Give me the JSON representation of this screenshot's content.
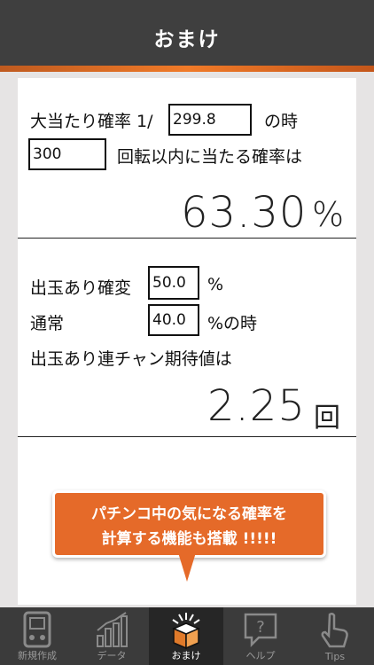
{
  "header": {
    "title": "おまけ"
  },
  "calc1": {
    "prob_label": "大当たり確率 1/",
    "prob_value": "299.8",
    "suffix1": "の時",
    "spins_value": "300",
    "suffix2": "回転以内に当たる確率は",
    "result": "63.30",
    "unit": "%"
  },
  "calc2": {
    "kakuhen_label": "出玉あり確変",
    "kakuhen_value": "50.0",
    "pct1": "%",
    "normal_label": "通常",
    "normal_value": "40.0",
    "pct2": "%の時",
    "expect_label": "出玉あり連チャン期待値は",
    "result": "2.25",
    "unit": "回"
  },
  "bubble": {
    "line1": "パチンコ中の気になる確率を",
    "line2": "計算する機能も搭載 !!!!!"
  },
  "tabs": [
    {
      "label": "新規作成",
      "icon": "new-record-icon"
    },
    {
      "label": "データ",
      "icon": "data-chart-icon"
    },
    {
      "label": "おまけ",
      "icon": "gift-box-icon"
    },
    {
      "label": "ヘルプ",
      "icon": "help-bubble-icon"
    },
    {
      "label": "Tips",
      "icon": "pointing-hand-icon"
    }
  ]
}
